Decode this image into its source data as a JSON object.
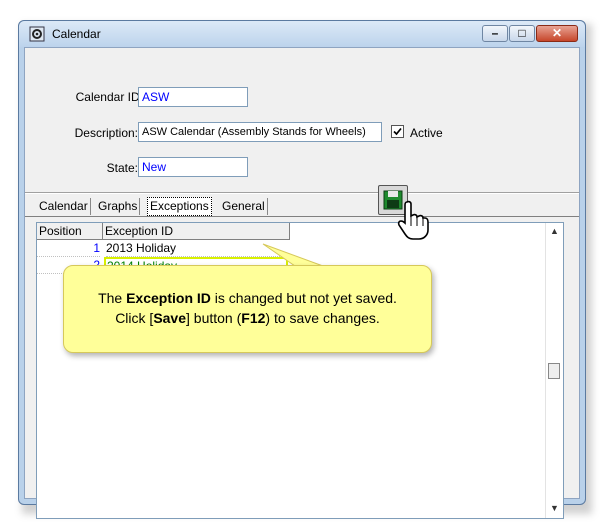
{
  "window": {
    "title": "Calendar"
  },
  "form": {
    "calendar_id_label": "Calendar ID:",
    "calendar_id_value": "ASW",
    "description_label": "Description:",
    "description_value": "ASW Calendar (Assembly Stands for Wheels)",
    "active_label": "Active",
    "active_checked": true,
    "state_label": "State:",
    "state_value": "New"
  },
  "tabs": [
    "Calendar",
    "Graphs",
    "Exceptions",
    "General"
  ],
  "active_tab": "Exceptions",
  "grid": {
    "columns": [
      "Position",
      "Exception ID"
    ],
    "rows": [
      {
        "position": "1",
        "exception_id": "2013 Holiday"
      },
      {
        "position": "2",
        "exception_id": "2014 Holiday"
      }
    ]
  },
  "callout": {
    "line1_pre": "The ",
    "line1_bold": "Exception  ID",
    "line1_post": " is changed but not yet saved.",
    "line2_pre": "Click [",
    "line2_bold1": "Save",
    "line2_mid": "] button (",
    "line2_bold2": "F12",
    "line2_post": ") to save changes."
  },
  "icons": {
    "app": "calendar-gear-icon",
    "save": "floppy-disk-icon",
    "pointer": "hand-pointer-icon"
  },
  "colors": {
    "modified_text": "#008000",
    "highlight_border": "#d8f000",
    "callout_bg": "#ffff99",
    "field_value": "#0000ff"
  }
}
